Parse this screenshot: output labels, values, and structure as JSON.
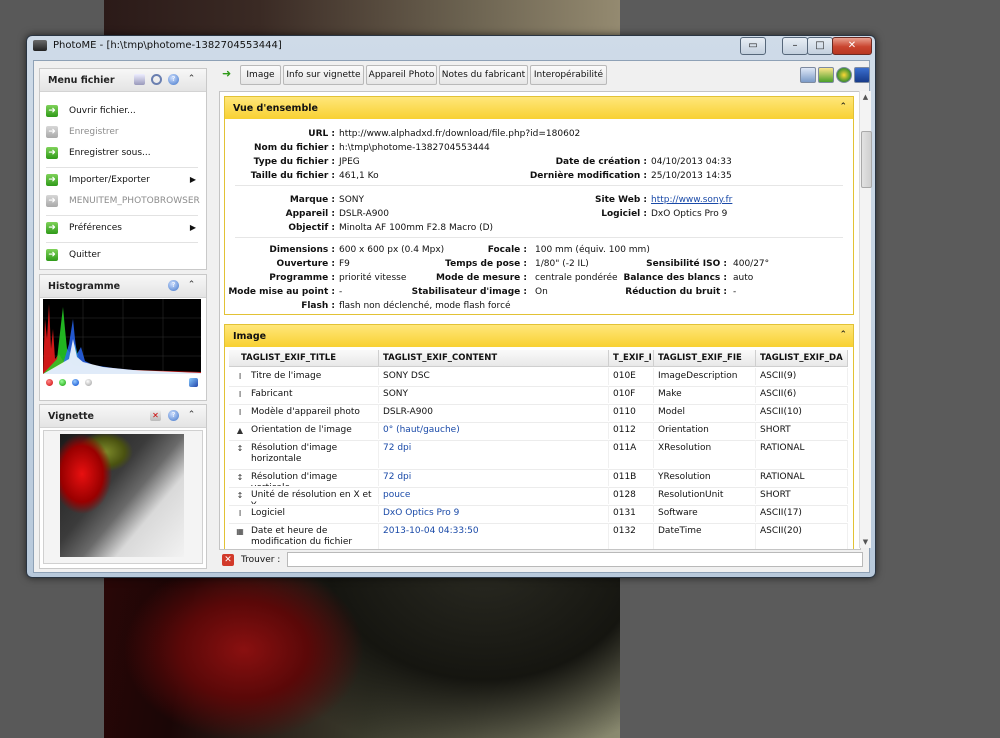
{
  "window": {
    "title": "PhotoME - [h:\\tmp\\photome-1382704553444]"
  },
  "menu_panel": {
    "title": "Menu fichier",
    "items": [
      {
        "label": "Ouvrir fichier...",
        "enabled": true
      },
      {
        "label": "Enregistrer",
        "enabled": false
      },
      {
        "label": "Enregistrer sous...",
        "enabled": true
      },
      {
        "label": "Importer/Exporter",
        "enabled": true,
        "submenu": true
      },
      {
        "label": "MENUITEM_PHOTOBROWSER",
        "enabled": false
      },
      {
        "label": "Préférences",
        "enabled": true,
        "submenu": true
      },
      {
        "label": "Quitter",
        "enabled": true
      }
    ]
  },
  "histogram_panel": {
    "title": "Histogramme"
  },
  "thumbnail_panel": {
    "title": "Vignette"
  },
  "tabs": [
    "Image",
    "Info sur vignette",
    "Appareil Photo",
    "Notes du fabricant",
    "Interopérabilité"
  ],
  "overview": {
    "title": "Vue d'ensemble",
    "url_label": "URL :",
    "url": "http://www.alphadxd.fr/download/file.php?id=180602",
    "filename_label": "Nom du fichier :",
    "filename": "h:\\tmp\\photome-1382704553444",
    "filetype_label": "Type du fichier :",
    "filetype": "JPEG",
    "filesize_label": "Taille du fichier :",
    "filesize": "461,1 Ko",
    "created_label": "Date de création :",
    "created": "04/10/2013 04:33",
    "modified_label": "Dernière modification :",
    "modified": "25/10/2013 14:35",
    "brand_label": "Marque :",
    "brand": "SONY",
    "camera_label": "Appareil :",
    "camera": "DSLR-A900",
    "lens_label": "Objectif :",
    "lens": "Minolta AF 100mm F2.8 Macro (D)",
    "website_label": "Site Web :",
    "website": "http://www.sony.fr",
    "software_label": "Logiciel :",
    "software": "DxO Optics Pro 9",
    "dimensions_label": "Dimensions :",
    "dimensions": "600 x 600 px (0.4 Mpx)",
    "aperture_label": "Ouverture :",
    "aperture": "F9",
    "program_label": "Programme :",
    "program": "priorité vitesse",
    "focusmode_label": "Mode mise au point :",
    "focusmode": "-",
    "flash_label": "Flash :",
    "flash": "flash non déclenché, mode flash forcé",
    "focal_label": "Focale :",
    "focal": "100 mm (équiv. 100 mm)",
    "exposure_label": "Temps de pose :",
    "exposure": "1/80\" (-2 IL)",
    "metering_label": "Mode de mesure :",
    "metering": "centrale pondérée",
    "stabilizer_label": "Stabilisateur d'image :",
    "stabilizer": "On",
    "iso_label": "Sensibilité ISO :",
    "iso": "400/27°",
    "wb_label": "Balance des blancs :",
    "wb": "auto",
    "noise_label": "Réduction du bruit :",
    "noise": "-"
  },
  "image_section": {
    "title": "Image",
    "columns": [
      "TAGLIST_EXIF_TITLE",
      "TAGLIST_EXIF_CONTENT",
      "T_EXIF_I",
      "TAGLIST_EXIF_FIE",
      "TAGLIST_EXIF_DA"
    ],
    "rows": [
      {
        "icon": "I",
        "title": "Titre de l'image",
        "content": "SONY DSC",
        "id": "010E",
        "field": "ImageDescription",
        "type": "ASCII(9)",
        "blue": false
      },
      {
        "icon": "I",
        "title": "Fabricant",
        "content": "SONY",
        "id": "010F",
        "field": "Make",
        "type": "ASCII(6)",
        "blue": false
      },
      {
        "icon": "I",
        "title": "Modèle d'appareil photo",
        "content": "DSLR-A900",
        "id": "0110",
        "field": "Model",
        "type": "ASCII(10)",
        "blue": false
      },
      {
        "icon": "▲",
        "title": "Orientation de l'image",
        "content": "0° (haut/gauche)",
        "id": "0112",
        "field": "Orientation",
        "type": "SHORT",
        "blue": true
      },
      {
        "icon": "↕",
        "title": "Résolution d'image horizontale",
        "content": "72 dpi",
        "id": "011A",
        "field": "XResolution",
        "type": "RATIONAL",
        "blue": true
      },
      {
        "icon": "↕",
        "title": "Résolution d'image verticale",
        "content": "72 dpi",
        "id": "011B",
        "field": "YResolution",
        "type": "RATIONAL",
        "blue": true
      },
      {
        "icon": "↕",
        "title": "Unité de résolution en X et Y",
        "content": "pouce",
        "id": "0128",
        "field": "ResolutionUnit",
        "type": "SHORT",
        "blue": true
      },
      {
        "icon": "I",
        "title": "Logiciel",
        "content": "DxO Optics Pro 9",
        "id": "0131",
        "field": "Software",
        "type": "ASCII(17)",
        "blue": true
      },
      {
        "icon": "▦",
        "title": "Date et heure de modification du fichier",
        "content": "2013-10-04 04:33:50",
        "id": "0132",
        "field": "DateTime",
        "type": "ASCII(20)",
        "blue": true
      }
    ]
  },
  "find_bar": {
    "label": "Trouver :",
    "value": ""
  }
}
